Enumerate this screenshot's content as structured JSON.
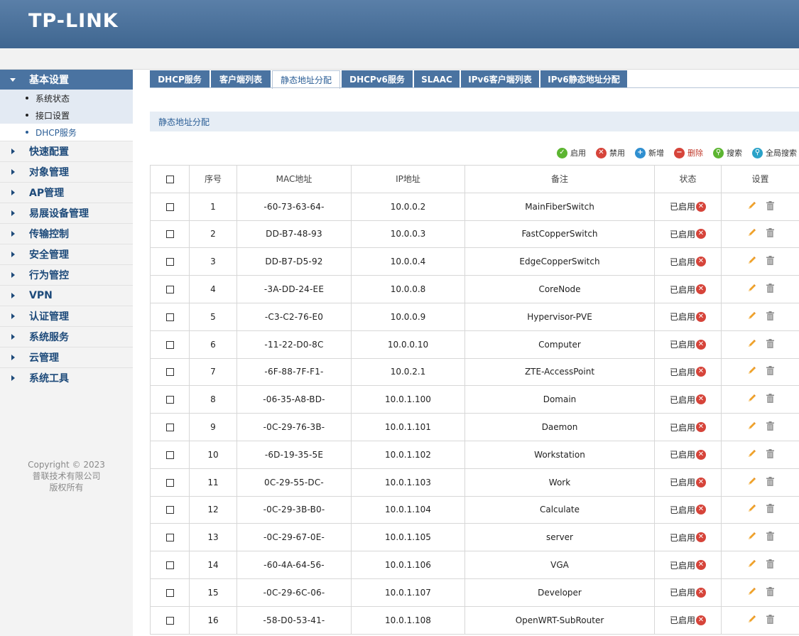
{
  "brand": "TP-LINK",
  "sidebar": {
    "expanded": {
      "label": "基本设置",
      "items": [
        {
          "label": "系统状态",
          "active": false
        },
        {
          "label": "接口设置",
          "active": false
        },
        {
          "label": "DHCP服务",
          "active": true
        }
      ]
    },
    "items": [
      "快速配置",
      "对象管理",
      "AP管理",
      "易展设备管理",
      "传输控制",
      "安全管理",
      "行为管控",
      "VPN",
      "认证管理",
      "系统服务",
      "云管理",
      "系统工具"
    ],
    "copyright": [
      "Copyright © 2023",
      "普联技术有限公司",
      "版权所有"
    ]
  },
  "tabs": [
    {
      "label": "DHCP服务",
      "active": false
    },
    {
      "label": "客户端列表",
      "active": false
    },
    {
      "label": "静态地址分配",
      "active": true
    },
    {
      "label": "DHCPv6服务",
      "active": false
    },
    {
      "label": "SLAAC",
      "active": false
    },
    {
      "label": "IPv6客户端列表",
      "active": false
    },
    {
      "label": "IPv6静态地址分配",
      "active": false
    }
  ],
  "section_title": "静态地址分配",
  "toolbar": {
    "enable": "启用",
    "disable": "禁用",
    "add": "新增",
    "delete": "删除",
    "search": "搜索",
    "global_search": "全局搜索"
  },
  "colors": {
    "header": "#4a73a1",
    "enable": "#5cb531",
    "disable": "#d6443a",
    "add": "#2f8fd0",
    "delete": "#d6443a",
    "search": "#5cb531",
    "global_search": "#2aa2c8"
  },
  "table": {
    "headers": {
      "index": "序号",
      "mac": "MAC地址",
      "ip": "IP地址",
      "note": "备注",
      "status": "状态",
      "settings": "设置"
    },
    "rows": [
      {
        "index": "1",
        "mac": "-60-73-63-64-",
        "ip": "10.0.0.2",
        "note": "MainFiberSwitch",
        "status": "已启用"
      },
      {
        "index": "2",
        "mac": "DD-B7-48-93",
        "ip": "10.0.0.3",
        "note": "FastCopperSwitch",
        "status": "已启用"
      },
      {
        "index": "3",
        "mac": "DD-B7-D5-92",
        "ip": "10.0.0.4",
        "note": "EdgeCopperSwitch",
        "status": "已启用"
      },
      {
        "index": "4",
        "mac": "-3A-DD-24-EE",
        "ip": "10.0.0.8",
        "note": "CoreNode",
        "status": "已启用"
      },
      {
        "index": "5",
        "mac": "-C3-C2-76-E0",
        "ip": "10.0.0.9",
        "note": "Hypervisor-PVE",
        "status": "已启用"
      },
      {
        "index": "6",
        "mac": "-11-22-D0-8C",
        "ip": "10.0.0.10",
        "note": "Computer",
        "status": "已启用"
      },
      {
        "index": "7",
        "mac": "-6F-88-7F-F1-",
        "ip": "10.0.2.1",
        "note": "ZTE-AccessPoint",
        "status": "已启用"
      },
      {
        "index": "8",
        "mac": "-06-35-A8-BD-",
        "ip": "10.0.1.100",
        "note": "Domain",
        "status": "已启用"
      },
      {
        "index": "9",
        "mac": "-0C-29-76-3B-",
        "ip": "10.0.1.101",
        "note": "Daemon",
        "status": "已启用"
      },
      {
        "index": "10",
        "mac": "-6D-19-35-5E",
        "ip": "10.0.1.102",
        "note": "Workstation",
        "status": "已启用"
      },
      {
        "index": "11",
        "mac": "0C-29-55-DC-",
        "ip": "10.0.1.103",
        "note": "Work",
        "status": "已启用"
      },
      {
        "index": "12",
        "mac": "-0C-29-3B-B0-",
        "ip": "10.0.1.104",
        "note": "Calculate",
        "status": "已启用"
      },
      {
        "index": "13",
        "mac": "-0C-29-67-0E-",
        "ip": "10.0.1.105",
        "note": "server",
        "status": "已启用"
      },
      {
        "index": "14",
        "mac": "-60-4A-64-56-",
        "ip": "10.0.1.106",
        "note": "VGA",
        "status": "已启用"
      },
      {
        "index": "15",
        "mac": "-0C-29-6C-06-",
        "ip": "10.0.1.107",
        "note": "Developer",
        "status": "已启用"
      },
      {
        "index": "16",
        "mac": "-58-D0-53-41-",
        "ip": "10.0.1.108",
        "note": "OpenWRT-SubRouter",
        "status": "已启用"
      }
    ]
  }
}
